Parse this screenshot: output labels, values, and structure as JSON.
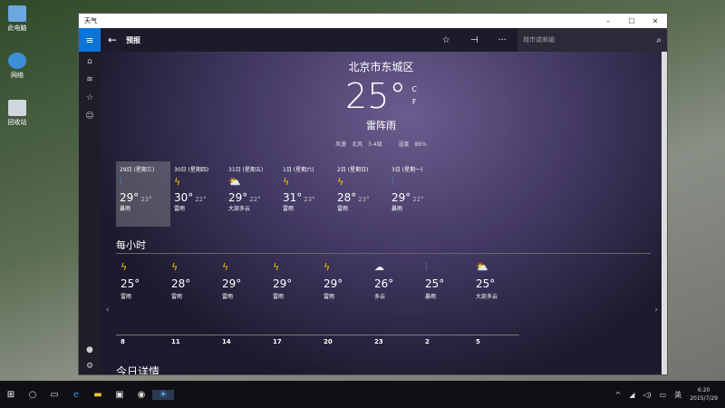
{
  "desktop": {
    "icons": [
      "此电脑",
      "网络",
      "回收站"
    ]
  },
  "window": {
    "title": "天气",
    "controls": [
      "–",
      "☐",
      "✕"
    ]
  },
  "appbar": {
    "title": "预报",
    "search_placeholder": "城市或邮编"
  },
  "current": {
    "city": "北京市东城区",
    "temp": "25°",
    "unit_c": "C",
    "unit_f": "F",
    "condition": "雷阵雨",
    "wind_label": "风速",
    "wind": "北风 3-4级",
    "humidity_label": "湿度",
    "humidity": "86%"
  },
  "daily": [
    {
      "date": "29日 (星期三)",
      "icon": "heavy-rain",
      "hi": "29°",
      "lo": "23°",
      "cond": "暴雨"
    },
    {
      "date": "30日 (星期四)",
      "icon": "thunder",
      "hi": "30°",
      "lo": "22°",
      "cond": "雷雨"
    },
    {
      "date": "31日 (星期五)",
      "icon": "partly-cloudy",
      "hi": "29°",
      "lo": "22°",
      "cond": "大部多云"
    },
    {
      "date": "1日 (星期六)",
      "icon": "thunder",
      "hi": "31°",
      "lo": "23°",
      "cond": "雷雨"
    },
    {
      "date": "2日 (星期日)",
      "icon": "thunder",
      "hi": "28°",
      "lo": "23°",
      "cond": "雷雨"
    },
    {
      "date": "3日 (星期一)",
      "icon": "heavy-rain",
      "hi": "29°",
      "lo": "22°",
      "cond": "暴雨"
    }
  ],
  "hourly_title": "每小时",
  "hourly": [
    {
      "icon": "thunder",
      "temp": "25°",
      "cond": "雷雨",
      "time": "8"
    },
    {
      "icon": "thunder",
      "temp": "28°",
      "cond": "雷雨",
      "time": "11"
    },
    {
      "icon": "thunder",
      "temp": "29°",
      "cond": "雷雨",
      "time": "14"
    },
    {
      "icon": "thunder",
      "temp": "29°",
      "cond": "雷雨",
      "time": "17"
    },
    {
      "icon": "thunder",
      "temp": "29°",
      "cond": "雷雨",
      "time": "20"
    },
    {
      "icon": "cloudy",
      "temp": "26°",
      "cond": "多云",
      "time": "23"
    },
    {
      "icon": "heavy-rain",
      "temp": "25°",
      "cond": "暴雨",
      "time": "2"
    },
    {
      "icon": "partly-cloudy",
      "temp": "25°",
      "cond": "大部多云",
      "time": "5"
    }
  ],
  "details_title": "今日详情",
  "taskbar": {
    "ime": "英",
    "time": "6:20",
    "date": "2015/7/29"
  }
}
